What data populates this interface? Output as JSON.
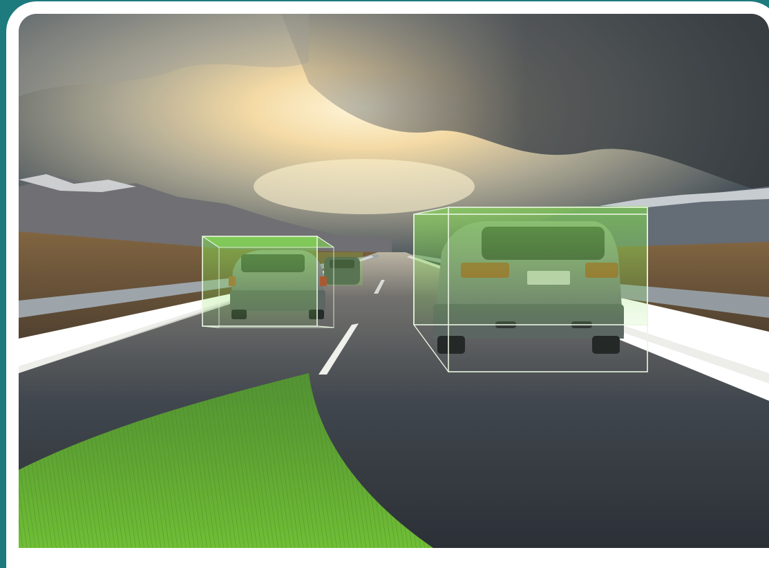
{
  "image": {
    "subject": "autonomous-driving-perception-scene",
    "detections": [
      {
        "id": "vehicle-left-near"
      },
      {
        "id": "vehicle-right-near"
      },
      {
        "id": "vehicle-far"
      }
    ],
    "colors": {
      "background": "#1d7a7d",
      "frame": "#ffffff",
      "detection_fill": "#7fe04a",
      "drivable_area": "#5fae2a",
      "road": "#2a3138",
      "sky_glow": "#fff2c8"
    }
  }
}
